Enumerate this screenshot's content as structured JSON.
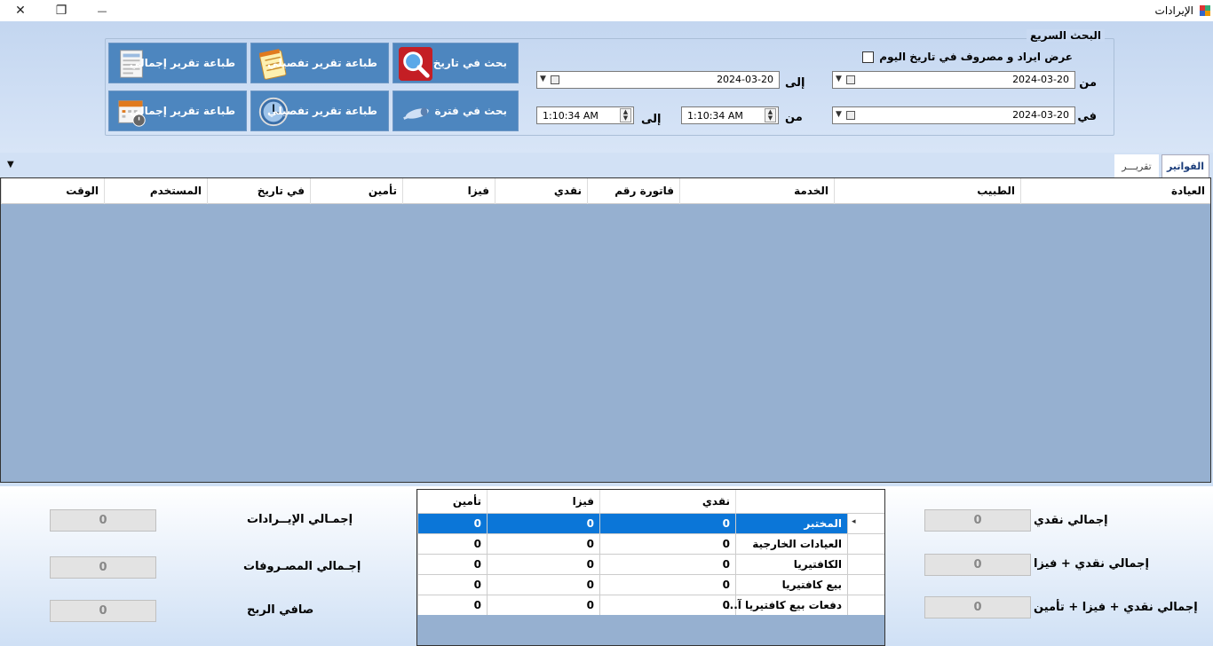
{
  "window": {
    "title": "الإيرادات",
    "controls": {
      "close": "✕",
      "restore": "❐",
      "minimize": "—"
    }
  },
  "quick_search": {
    "legend": "البحث السريع",
    "show_today_label": "عرض ايراد و مصروف في تاريخ اليوم",
    "from_label": "من",
    "to_label": "إلى",
    "in_label": "في",
    "date_from": "2024-03-20",
    "date_to": "2024-03-20",
    "date_in": "2024-03-20",
    "time_from_label": "من",
    "time_to_label": "إلى",
    "time_from": "1:10:34 AM",
    "time_to": "1:10:34 AM"
  },
  "buttons": {
    "search_date": "بحث في تاريخ",
    "search_period": "بحث في فترة",
    "print_detailed_1": "طباعة تقرير تفصيلي",
    "print_detailed_2": "طباعة تقرير تفصيلي",
    "print_total_1": "طباعة تقرير إجمالي",
    "print_total_2": "طباعة تقرير إجمالي"
  },
  "tabs": [
    {
      "label": "الفواتير",
      "active": true
    },
    {
      "label": "تقريـــر",
      "active": false
    }
  ],
  "invoice_grid": {
    "columns": [
      "العيادة",
      "الطبيب",
      "الخدمة",
      "فاتورة رقم",
      "نقدي",
      "فيزا",
      "تأمين",
      "في تاريخ",
      "المستخدم",
      "الوقت"
    ]
  },
  "totals_left": {
    "revenue_label": "إجمـالي الإيــرادات",
    "revenue_value": "0",
    "expenses_label": "إجـمالي المصـروفات",
    "expenses_value": "0",
    "profit_label": "صافي الربح",
    "profit_value": "0"
  },
  "totals_right": {
    "cash_label": "إجمالي نقدي",
    "cash_value": "0",
    "cash_visa_label": "إجمالي نقدي + فيزا",
    "cash_visa_value": "0",
    "cash_visa_ins_label": "إجمالي نقدي + فيزا + تأمين",
    "cash_visa_ins_value": "0"
  },
  "summary_grid": {
    "columns": [
      "نقدي",
      "فيزا",
      "تأمين"
    ],
    "rows": [
      {
        "name": "المختبر",
        "cash": "0",
        "visa": "0",
        "insurance": "0"
      },
      {
        "name": "العيادات الخارجية",
        "cash": "0",
        "visa": "0",
        "insurance": "0"
      },
      {
        "name": "الكافتيريا",
        "cash": "0",
        "visa": "0",
        "insurance": "0"
      },
      {
        "name": "بيع كافتيريا",
        "cash": "0",
        "visa": "0",
        "insurance": "0"
      },
      {
        "name": "دفعات بيع كافتيريا آ...",
        "cash": "0",
        "visa": "0",
        "insurance": "0"
      }
    ],
    "row_indicator": "◂"
  },
  "icons": {
    "search_date": "magnifier-icon",
    "search_period": "telescope-icon",
    "print_detailed_1": "notepad-icon",
    "print_detailed_2": "clock-icon",
    "print_total_1": "report-icon",
    "print_total_2": "calendar-icon"
  },
  "colors": {
    "button_bg": "#4d86bf",
    "grid_bg": "#96b0d0",
    "selected_row": "#0b76d8",
    "window_bg": "#cfe0f5"
  }
}
